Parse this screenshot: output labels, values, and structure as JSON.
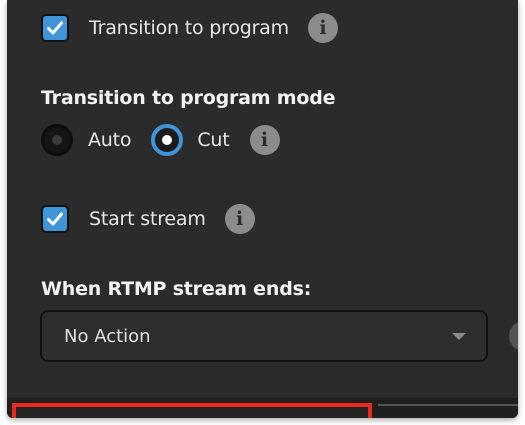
{
  "options": {
    "transition_to_program": {
      "label": "Transition to program",
      "checked": true
    },
    "mode_heading": "Transition to program mode",
    "mode_options": [
      {
        "label": "Auto",
        "selected": false
      },
      {
        "label": "Cut",
        "selected": true
      }
    ],
    "start_stream": {
      "label": "Start stream",
      "checked": true
    },
    "rtmp_heading": "When RTMP stream ends:",
    "rtmp_action": {
      "value": "No Action"
    }
  },
  "icons": {
    "info_glyph": "i",
    "checkmark": "check-icon"
  },
  "colors": {
    "accent": "#3f95d8",
    "panel_bg": "#2b2b2b",
    "highlight_box": "#e8291c"
  }
}
